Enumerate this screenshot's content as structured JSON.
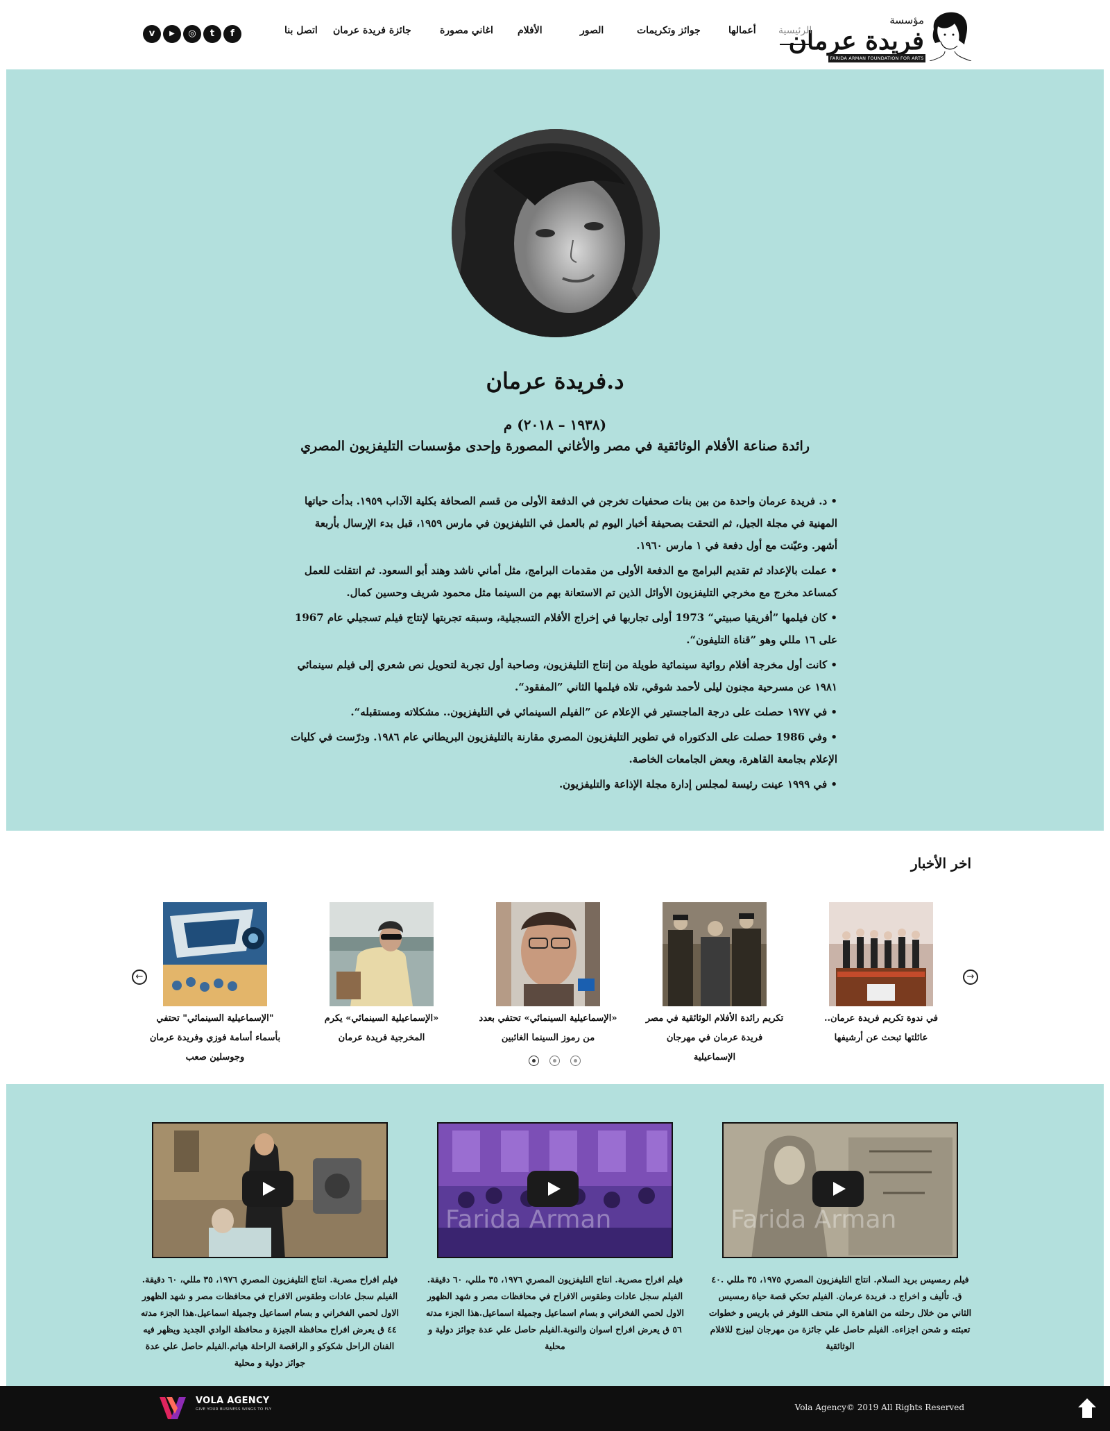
{
  "header": {
    "logo_prefix": "مؤسسة",
    "logo_name": "فريدة عرمان",
    "logo_tagline": "FARIDA ARMAN FOUNDATION FOR ARTS",
    "nav": [
      {
        "label": "الرئيسية",
        "active": true
      },
      {
        "label": "أعمالها"
      },
      {
        "label": "جوائز وتكريمات"
      },
      {
        "label": "الصور"
      },
      {
        "label": "الأفلام"
      },
      {
        "label": "اغاني مصورة"
      },
      {
        "label": "جائزة فريدة عرمان"
      },
      {
        "label": "اتصل بنا"
      }
    ],
    "socials": [
      {
        "name": "facebook",
        "glyph": "f"
      },
      {
        "name": "twitter",
        "glyph": "t"
      },
      {
        "name": "instagram",
        "glyph": "◎"
      },
      {
        "name": "youtube",
        "glyph": "▶"
      },
      {
        "name": "vimeo",
        "glyph": "v"
      }
    ]
  },
  "hero": {
    "name": "د.فريدة عرمان",
    "years": "(١٩٣٨ – ٢٠١٨) م",
    "subtitle": "رائدة صناعة الأفلام الوثائقية في مصر والأغاني المصورة وإحدى مؤسسات التليفزيون المصري",
    "bio": [
      "د. فريدة عرمان واحدة من بين بنات صحفيات تخرجن في الدفعة الأولى من قسم الصحافة بكلية الآداب ١٩٥٩. بدأت حياتها المهنية في مجلة الجيل، ثم التحقت بصحيفة أخبار اليوم ثم بالعمل في التليفزيون في مارس ١٩٥٩، قبل بدء الإرسال بأربعة أشهر. وعيّنت مع أول دفعة في ١ مارس ١٩٦٠.",
      "عملت بالإعداد ثم تقديم البرامج مع الدفعة الأولى من مقدمات البرامج، مثل أماني ناشد وهند أبو السعود. ثم انتقلت للعمل كمساعد مخرج مع مخرجي التليفزيون الأوائل الذين تم الاستعانة بهم من السينما مثل محمود شريف وحسين كمال.",
      "كان فيلمها ”أفريقيا صبيتي“ 1973 أولى تجاربها في إخراج الأفلام التسجيلية، وسبقه تجربتها لإنتاج فيلم تسجيلي عام 1967 على ١٦ مللي وهو ”قناة التليفون“.",
      "كانت أول مخرجة أفلام روائية سينمائية طويلة من إنتاج التليفزيون، وصاحبة أول تجربة لتحويل نص شعري إلى فيلم سينمائي ١٩٨١ عن مسرحية مجنون ليلى لأحمد شوقي، تلاه فيلمها الثاني ”المفقود“.",
      "في ١٩٧٧ حصلت على درجة الماجستير في الإعلام عن ”الفيلم السينمائي في التليفزيون.. مشكلاته ومستقبله“.",
      "وفي 1986 حصلت على الدكتوراه في تطوير التليفزيون المصري مقارنة بالتليفزيون البريطاني عام ١٩٨٦. ودرّست في كليات الإعلام بجامعة القاهرة، وبعض الجامعات الخاصة.",
      "في ١٩٩٩ عينت رئيسة لمجلس إدارة مجلة الإذاعة والتليفزيون."
    ]
  },
  "news": {
    "title": "اخر الأخبار",
    "items": [
      {
        "caption": "في ندوة تكريم فريدة عرمان.. عائلتها تبحث عن أرشيفها"
      },
      {
        "caption": "تكريم رائدة الأفلام الوثائقية في مصر فريدة عرمان في مهرجان الإسماعيلية"
      },
      {
        "caption": "«الإسماعيلية السينمائي» تحتفي بعدد من رموز السينما الغائبين"
      },
      {
        "caption": "«الإسماعيلية السينمائي» يكرم المخرجية فريدة عرمان"
      },
      {
        "caption": "\"الإسماعيلية السينمائي\" تحتفي بأسماء أسامة فوزي وفريدة عرمان وجوسلين صعب"
      }
    ],
    "pager_pages": 3,
    "pager_active": 1
  },
  "videos": [
    {
      "watermark": "Farida Arman",
      "description": "فيلم رمسيس بريد السلام. انتاج التليفزيون المصري ١٩٧٥، ٣٥ مللي .٤٠ ق. تأليف و اخراج د. فريدة عرمان. الفيلم تحكي قصة حياة رمسيس الثاني من خلال رحلته من القاهرة الي متحف اللوفر في باريس و خطوات تعبئته و شحن اجزاءه. الفيلم حاصل علي جائزة من مهرجان لبيزج للافلام الوثائقية"
    },
    {
      "watermark": "Farida Arman",
      "description": "فيلم افراح مصرية. انتاج التليفزيون المصري ١٩٧٦، ٣٥ مللي، ٦٠ دقيقة. الفيلم سجل عادات وطقوس الافراح في محافظات مصر و شهد الظهور الاول لحمي الفخراني و بسام اسماعيل وجميلة اسماعيل.هذا الجزء مدته ٥٦ ق يعرض افراح اسوان والنوبة.الفيلم حاصل علي عدة جوائز دولية و محلية"
    },
    {
      "watermark": "",
      "description": "فيلم افراح مصرية. انتاج التليفزيون المصري ١٩٧٦، ٣٥ مللي، ٦٠ دقيقة. الفيلم سجل عادات وطقوس الافراح في محافظات مصر و شهد الظهور الاول لحمي الفخراني و بسام اسماعيل وجميلة اسماعيل.هذا الجزء مدته ٤٤ ق يعرض افراح محافظة الجيزة و محافظة الوادي الجديد ويظهر فيه الفنان الراحل شكوكو و الراقصة الراحلة هياتم.الفيلم حاصل علي عدة جوائز دولية و محلية"
    }
  ],
  "footer": {
    "agency_name": "VOLA AGENCY",
    "agency_tagline": "GIVE YOUR BUSINESS WINGS TO FLY",
    "copyright": "Vola Agency© 2019 All Rights Reserved"
  }
}
